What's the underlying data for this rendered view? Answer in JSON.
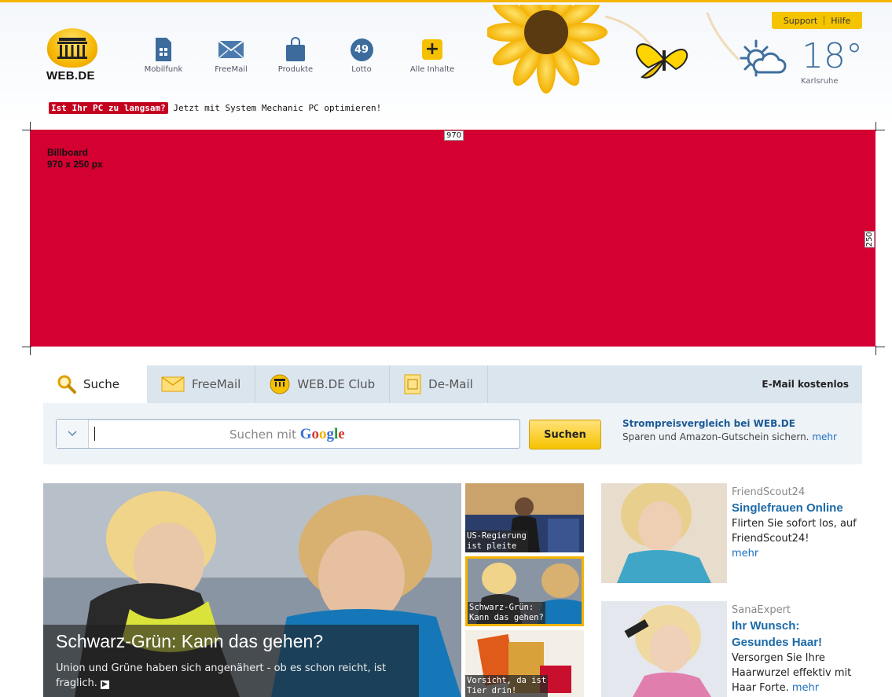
{
  "header": {
    "logo_text": "WEB.DE",
    "nav": [
      {
        "label": "Mobilfunk",
        "icon": "sim-card-icon"
      },
      {
        "label": "FreeMail",
        "icon": "envelope-icon"
      },
      {
        "label": "Produkte",
        "icon": "shopping-bag-icon"
      },
      {
        "label": "Lotto",
        "icon": "lotto-ball-icon",
        "badge": "49"
      },
      {
        "label": "Alle Inhalte",
        "icon": "plus-icon"
      }
    ],
    "support": "Support",
    "help": "Hilfe",
    "weather": {
      "temp": "18°",
      "city": "Karlsruhe",
      "icon": "sun-cloud-icon"
    },
    "promo_tag": "Ist Ihr PC zu langsam?",
    "promo_text": "Jetzt mit System Mechanic PC optimieren!"
  },
  "billboard": {
    "label_line1": "Billboard",
    "label_line2": "970 x 250 px",
    "width_label": "970",
    "height_label": "250",
    "color": "#d30031"
  },
  "search": {
    "tabs": [
      "Suche",
      "FreeMail",
      "WEB.DE Club",
      "De-Mail"
    ],
    "right_link": "E-Mail kostenlos",
    "placeholder_prefix": "Suchen mit",
    "google_letters": [
      "G",
      "o",
      "o",
      "g",
      "l",
      "e"
    ],
    "button": "Suchen",
    "promo_title": "Strompreisvergleich bei WEB.DE",
    "promo_text": "Sparen und Amazon-Gutschein sichern.",
    "promo_more": "mehr"
  },
  "news": {
    "headline": "Schwarz-Grün: Kann das gehen?",
    "teaser": "Union und Grüne haben sich angenähert - ob es schon reicht, ist fraglich.",
    "thumbs": [
      {
        "line1": "US-Regierung",
        "line2": "ist pleite"
      },
      {
        "line1": "Schwarz-Grün:",
        "line2": "Kann das gehen?"
      },
      {
        "line1": "Vorsicht, da ist",
        "line2": "Tier drin!"
      }
    ]
  },
  "ads": [
    {
      "source": "FriendScout24",
      "title": "Singlefrauen Online",
      "text": "Flirten Sie sofort los, auf FriendScout24!",
      "more": "mehr"
    },
    {
      "source": "SanaExpert",
      "title": "Ihr Wunsch: Gesundes Haar!",
      "text": "Versorgen Sie Ihre Haarwurzel effektiv mit Haar Forte.",
      "more": "mehr"
    }
  ]
}
